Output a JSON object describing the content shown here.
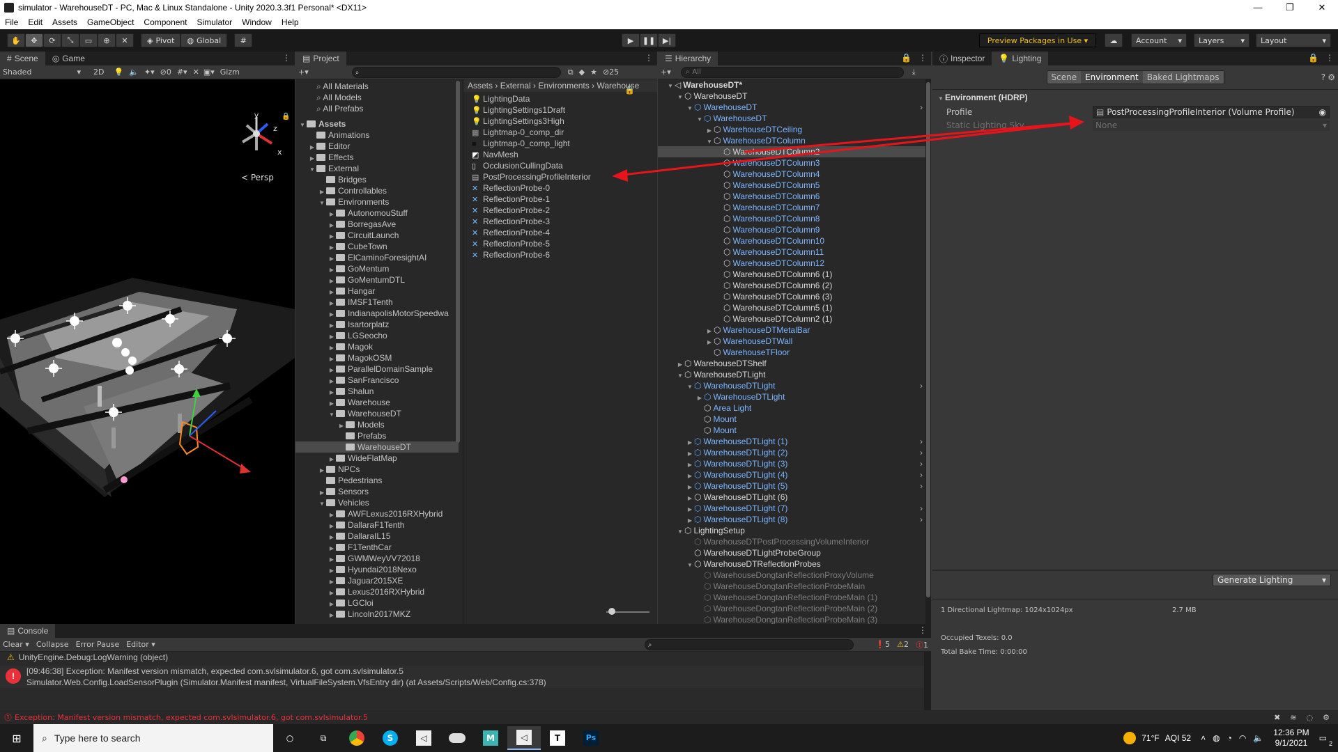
{
  "window": {
    "title": "simulator - WarehouseDT - PC, Mac & Linux Standalone - Unity 2020.3.3f1 Personal* <DX11>",
    "controls": [
      "—",
      "❐",
      "✕"
    ]
  },
  "menu": [
    "File",
    "Edit",
    "Assets",
    "GameObject",
    "Component",
    "Simulator",
    "Window",
    "Help"
  ],
  "toolbar": {
    "pivot": "Pivot",
    "global": "Global",
    "preview_packages": "Preview Packages in Use ▾",
    "account": "Account",
    "layers": "Layers",
    "layout": "Layout"
  },
  "scene": {
    "tabs": [
      "Scene",
      "Game"
    ],
    "shading": "Shaded",
    "mode_2d": "2D",
    "hidden_count": "0",
    "gizmos": "Gizm",
    "persp": "Persp",
    "axis_labels": [
      "y",
      "z",
      "x"
    ]
  },
  "project": {
    "tab": "Project",
    "count": "25",
    "favorites": [
      "All Materials",
      "All Models",
      "All Prefabs"
    ],
    "tree": [
      {
        "label": "Assets",
        "depth": 0,
        "open": true,
        "bold": true
      },
      {
        "label": "Animations",
        "depth": 1
      },
      {
        "label": "Editor",
        "depth": 1,
        "arrow": true
      },
      {
        "label": "Effects",
        "depth": 1,
        "arrow": true
      },
      {
        "label": "External",
        "depth": 1,
        "open": true
      },
      {
        "label": "Bridges",
        "depth": 2
      },
      {
        "label": "Controllables",
        "depth": 2,
        "arrow": true
      },
      {
        "label": "Environments",
        "depth": 2,
        "open": true
      },
      {
        "label": "AutonomouStuff",
        "depth": 3,
        "arrow": true
      },
      {
        "label": "BorregasAve",
        "depth": 3,
        "arrow": true
      },
      {
        "label": "CircuitLaunch",
        "depth": 3,
        "arrow": true
      },
      {
        "label": "CubeTown",
        "depth": 3,
        "arrow": true
      },
      {
        "label": "ElCaminoForesightAI",
        "depth": 3,
        "arrow": true
      },
      {
        "label": "GoMentum",
        "depth": 3,
        "arrow": true
      },
      {
        "label": "GoMentumDTL",
        "depth": 3,
        "arrow": true
      },
      {
        "label": "Hangar",
        "depth": 3,
        "arrow": true
      },
      {
        "label": "IMSF1Tenth",
        "depth": 3,
        "arrow": true
      },
      {
        "label": "IndianapolisMotorSpeedwa",
        "depth": 3,
        "arrow": true
      },
      {
        "label": "Isartorplatz",
        "depth": 3,
        "arrow": true
      },
      {
        "label": "LGSeocho",
        "depth": 3,
        "arrow": true
      },
      {
        "label": "Magok",
        "depth": 3,
        "arrow": true
      },
      {
        "label": "MagokOSM",
        "depth": 3,
        "arrow": true
      },
      {
        "label": "ParallelDomainSample",
        "depth": 3,
        "arrow": true
      },
      {
        "label": "SanFrancisco",
        "depth": 3,
        "arrow": true
      },
      {
        "label": "Shalun",
        "depth": 3,
        "arrow": true
      },
      {
        "label": "Warehouse",
        "depth": 3,
        "arrow": true
      },
      {
        "label": "WarehouseDT",
        "depth": 3,
        "open": true
      },
      {
        "label": "Models",
        "depth": 4,
        "arrow": true
      },
      {
        "label": "Prefabs",
        "depth": 4
      },
      {
        "label": "WarehouseDT",
        "depth": 4,
        "selected": true
      },
      {
        "label": "WideFlatMap",
        "depth": 3,
        "arrow": true
      },
      {
        "label": "NPCs",
        "depth": 2,
        "arrow": true
      },
      {
        "label": "Pedestrians",
        "depth": 2
      },
      {
        "label": "Sensors",
        "depth": 2,
        "arrow": true
      },
      {
        "label": "Vehicles",
        "depth": 2,
        "open": true
      },
      {
        "label": "AWFLexus2016RXHybrid",
        "depth": 3,
        "arrow": true
      },
      {
        "label": "DallaraF1Tenth",
        "depth": 3,
        "arrow": true
      },
      {
        "label": "DallaraIL15",
        "depth": 3,
        "arrow": true
      },
      {
        "label": "F1TenthCar",
        "depth": 3,
        "arrow": true
      },
      {
        "label": "GWMWeyVV72018",
        "depth": 3,
        "arrow": true
      },
      {
        "label": "Hyundai2018Nexo",
        "depth": 3,
        "arrow": true
      },
      {
        "label": "Jaguar2015XE",
        "depth": 3,
        "arrow": true
      },
      {
        "label": "Lexus2016RXHybrid",
        "depth": 3,
        "arrow": true
      },
      {
        "label": "LGCloi",
        "depth": 3,
        "arrow": true
      },
      {
        "label": "Lincoln2017MKZ",
        "depth": 3,
        "arrow": true
      }
    ],
    "breadcrumb": [
      "Assets",
      "External",
      "Environments",
      "Warehouse"
    ],
    "files": [
      {
        "label": "LightingData",
        "icon": "lightbulb-icon"
      },
      {
        "label": "LightingSettings1Draft",
        "icon": "lightbulb-icon"
      },
      {
        "label": "LightingSettings3High",
        "icon": "lightbulb-icon"
      },
      {
        "label": "Lightmap-0_comp_dir",
        "icon": "texture-icon"
      },
      {
        "label": "Lightmap-0_comp_light",
        "icon": "texture-dark-icon"
      },
      {
        "label": "NavMesh",
        "icon": "navmesh-icon"
      },
      {
        "label": "OcclusionCullingData",
        "icon": "document-icon"
      },
      {
        "label": "PostProcessingProfileInterior",
        "icon": "profile-icon"
      },
      {
        "label": "ReflectionProbe-0",
        "icon": "probe-icon"
      },
      {
        "label": "ReflectionProbe-1",
        "icon": "probe-icon"
      },
      {
        "label": "ReflectionProbe-2",
        "icon": "probe-icon"
      },
      {
        "label": "ReflectionProbe-3",
        "icon": "probe-icon"
      },
      {
        "label": "ReflectionProbe-4",
        "icon": "probe-icon"
      },
      {
        "label": "ReflectionProbe-5",
        "icon": "probe-icon"
      },
      {
        "label": "ReflectionProbe-6",
        "icon": "probe-icon"
      }
    ]
  },
  "hierarchy": {
    "tab": "Hierarchy",
    "search_placeholder": "All",
    "items": [
      {
        "label": "WarehouseDT*",
        "depth": 0,
        "color": "white",
        "bold": true,
        "open": true,
        "icon": "unity-scene-icon"
      },
      {
        "label": "WarehouseDT",
        "depth": 1,
        "color": "white",
        "open": true
      },
      {
        "label": "WarehouseDT",
        "depth": 2,
        "color": "blue",
        "open": true,
        "chev": true,
        "prefab": true
      },
      {
        "label": "WarehouseDT",
        "depth": 3,
        "color": "blue",
        "open": true,
        "prefab": true
      },
      {
        "label": "WarehouseDTCeiling",
        "depth": 4,
        "color": "blue",
        "arrow": true
      },
      {
        "label": "WarehouseDTColumn",
        "depth": 4,
        "color": "blue",
        "open": true
      },
      {
        "label": "WarehouseDTColumn2",
        "depth": 5,
        "color": "white",
        "selected": true
      },
      {
        "label": "WarehouseDTColumn3",
        "depth": 5,
        "color": "blue"
      },
      {
        "label": "WarehouseDTColumn4",
        "depth": 5,
        "color": "blue"
      },
      {
        "label": "WarehouseDTColumn5",
        "depth": 5,
        "color": "blue"
      },
      {
        "label": "WarehouseDTColumn6",
        "depth": 5,
        "color": "blue"
      },
      {
        "label": "WarehouseDTColumn7",
        "depth": 5,
        "color": "blue"
      },
      {
        "label": "WarehouseDTColumn8",
        "depth": 5,
        "color": "blue"
      },
      {
        "label": "WarehouseDTColumn9",
        "depth": 5,
        "color": "blue"
      },
      {
        "label": "WarehouseDTColumn10",
        "depth": 5,
        "color": "blue"
      },
      {
        "label": "WarehouseDTColumn11",
        "depth": 5,
        "color": "blue"
      },
      {
        "label": "WarehouseDTColumn12",
        "depth": 5,
        "color": "blue"
      },
      {
        "label": "WarehouseDTColumn6 (1)",
        "depth": 5,
        "color": "white"
      },
      {
        "label": "WarehouseDTColumn6 (2)",
        "depth": 5,
        "color": "white"
      },
      {
        "label": "WarehouseDTColumn6 (3)",
        "depth": 5,
        "color": "white"
      },
      {
        "label": "WarehouseDTColumn5 (1)",
        "depth": 5,
        "color": "white"
      },
      {
        "label": "WarehouseDTColumn2 (1)",
        "depth": 5,
        "color": "white"
      },
      {
        "label": "WarehouseDTMetalBar",
        "depth": 4,
        "color": "blue",
        "arrow": true
      },
      {
        "label": "WarehouseDTWall",
        "depth": 4,
        "color": "blue",
        "arrow": true
      },
      {
        "label": "WarehouseTFloor",
        "depth": 4,
        "color": "blue"
      },
      {
        "label": "WarehouseDTShelf",
        "depth": 1,
        "color": "white",
        "arrow": true
      },
      {
        "label": "WarehouseDTLight",
        "depth": 1,
        "color": "white",
        "open": true
      },
      {
        "label": "WarehouseDTLight",
        "depth": 2,
        "color": "blue",
        "open": true,
        "chev": true,
        "prefab": true
      },
      {
        "label": "WarehouseDTLight",
        "depth": 3,
        "color": "blue",
        "arrow": true,
        "prefab": true
      },
      {
        "label": "Area Light",
        "depth": 3,
        "color": "blue"
      },
      {
        "label": "Mount",
        "depth": 3,
        "color": "blue"
      },
      {
        "label": "Mount",
        "depth": 3,
        "color": "blue"
      },
      {
        "label": "WarehouseDTLight (1)",
        "depth": 2,
        "color": "blue",
        "arrow": true,
        "chev": true,
        "prefab": true
      },
      {
        "label": "WarehouseDTLight (2)",
        "depth": 2,
        "color": "blue",
        "arrow": true,
        "chev": true,
        "prefab": true
      },
      {
        "label": "WarehouseDTLight (3)",
        "depth": 2,
        "color": "blue",
        "arrow": true,
        "chev": true,
        "prefab": true
      },
      {
        "label": "WarehouseDTLight (4)",
        "depth": 2,
        "color": "blue",
        "arrow": true,
        "chev": true,
        "prefab": true
      },
      {
        "label": "WarehouseDTLight (5)",
        "depth": 2,
        "color": "blue",
        "arrow": true,
        "chev": true,
        "prefab": true
      },
      {
        "label": "WarehouseDTLight (6)",
        "depth": 2,
        "color": "white",
        "arrow": true
      },
      {
        "label": "WarehouseDTLight (7)",
        "depth": 2,
        "color": "blue",
        "arrow": true,
        "chev": true,
        "prefab": true
      },
      {
        "label": "WarehouseDTLight (8)",
        "depth": 2,
        "color": "blue",
        "arrow": true,
        "chev": true,
        "prefab": true
      },
      {
        "label": "LightingSetup",
        "depth": 1,
        "color": "white",
        "open": true
      },
      {
        "label": "WarehouseDTPostProcessingVolumeInterior",
        "depth": 2,
        "color": "grey"
      },
      {
        "label": "WarehouseDTLightProbeGroup",
        "depth": 2,
        "color": "white"
      },
      {
        "label": "WarehouseDTReflectionProbes",
        "depth": 2,
        "color": "white",
        "open": true
      },
      {
        "label": "WarehouseDongtanReflectionProxyVolume",
        "depth": 3,
        "color": "grey"
      },
      {
        "label": "WarehouseDongtanReflectionProbeMain",
        "depth": 3,
        "color": "grey"
      },
      {
        "label": "WarehouseDongtanReflectionProbeMain (1)",
        "depth": 3,
        "color": "grey"
      },
      {
        "label": "WarehouseDongtanReflectionProbeMain (2)",
        "depth": 3,
        "color": "grey"
      },
      {
        "label": "WarehouseDongtanReflectionProbeMain (3)",
        "depth": 3,
        "color": "grey"
      }
    ]
  },
  "inspector": {
    "tabs": [
      "Inspector",
      "Lighting"
    ],
    "subtabs": [
      "Scene",
      "Environment",
      "Baked Lightmaps"
    ],
    "section": "Environment (HDRP)",
    "profile_label": "Profile",
    "profile_value": "PostProcessingProfileInterior (Volume Profile)",
    "sky_label": "Static Lighting Sky",
    "sky_value": "None",
    "generate": "Generate Lighting",
    "stats": {
      "lightmap": "1 Directional Lightmap: 1024x1024px",
      "size": "2.7 MB",
      "texels": "Occupied Texels: 0.0",
      "bake_time": "Total Bake Time: 0:00:00"
    }
  },
  "console": {
    "tab": "Console",
    "buttons": [
      "Clear",
      "Collapse",
      "Error Pause",
      "Editor"
    ],
    "counts": {
      "info": "5",
      "warn": "2",
      "error": "1"
    },
    "warning_line": "UnityEngine.Debug:LogWarning (object)",
    "error_line1": "[09:46:38] Exception: Manifest version mismatch, expected com.svlsimulator.6, got com.svlsimulator.5",
    "error_line2": "Simulator.Web.Config.LoadSensorPlugin (Simulator.Manifest manifest, VirtualFileSystem.VfsEntry dir) (at Assets/Scripts/Web/Config.cs:378)"
  },
  "statusbar": {
    "message": "Exception: Manifest version mismatch, expected com.svlsimulator.6, got com.svlsimulator.5"
  },
  "taskbar": {
    "search_placeholder": "Type here to search",
    "weather": "71°F",
    "aqi": "AQI 52",
    "time": "12:36 PM",
    "date": "9/1/2021",
    "notifications": "2"
  },
  "colors": {
    "annotation_arrow": "#e8141b",
    "error": "#e8323b",
    "warning": "#f0c020",
    "prefab_blue": "#7cb6ff"
  }
}
